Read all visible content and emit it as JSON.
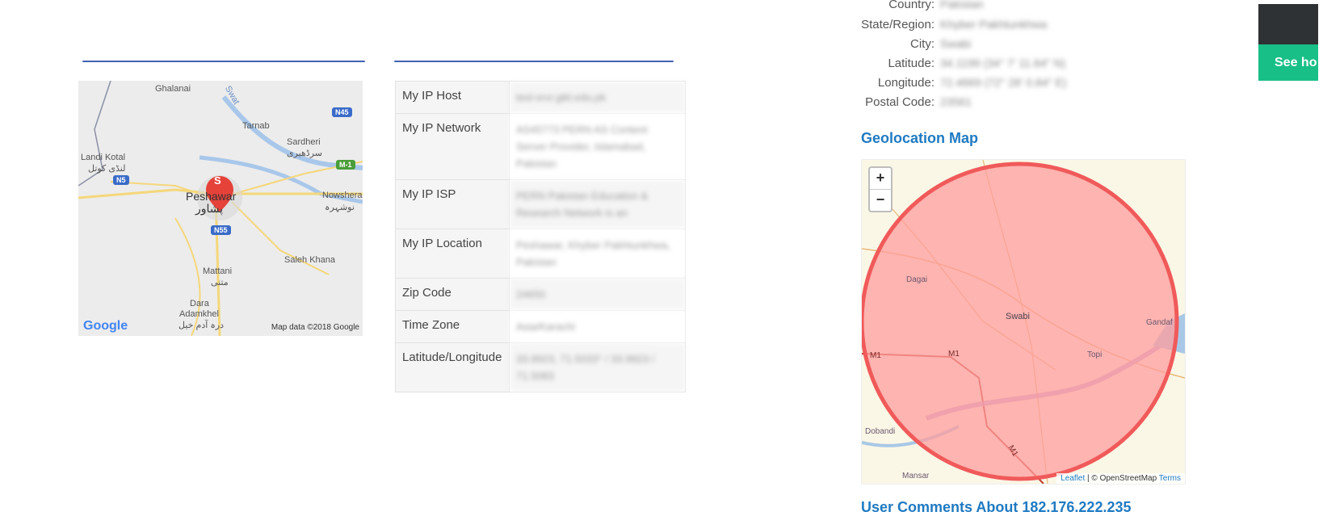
{
  "left_map": {
    "places": [
      "Ghalanai",
      "Tarnab",
      "Sardheri",
      "سرڈھیری",
      "Landi Kotal",
      "لنڈی کوتل",
      "Peshawar",
      "پشاور",
      "Nowshera",
      "نوشہرہ",
      "Saleh Khana",
      "Mattani",
      "متنی",
      "Dara",
      "Adamkhel",
      "درہ آدم خیل",
      "Swat"
    ],
    "shields": [
      "N45",
      "M-1",
      "N5",
      "N55"
    ],
    "marker_letter": "S",
    "logo": "Google",
    "attribution": "Map data ©2018 Google"
  },
  "ip_table": {
    "rows": [
      {
        "key": "My IP Host",
        "value": "tesl-srvr.gikl.edu.pk"
      },
      {
        "key": "My IP Network",
        "value": "AS45773 PERN AS Content Server Provider, Islamabad, Pakistan"
      },
      {
        "key": "My IP ISP",
        "value": "PERN Pakistan Education & Research Network is an"
      },
      {
        "key": "My IP Location",
        "value": "Peshawar, Khyber Pakhtunkhwa, Pakistan"
      },
      {
        "key": "Zip Code",
        "value": "24650"
      },
      {
        "key": "Time Zone",
        "value": "Asia/Karachi"
      },
      {
        "key": "Latitude/Longitude",
        "value": "33.9923, 71.5033° / 33.9923 / 71.5083"
      }
    ]
  },
  "info": {
    "rows": [
      {
        "label": "Country:",
        "value": "Pakistan"
      },
      {
        "label": "State/Region:",
        "value": "Khyber Pakhtunkhwa"
      },
      {
        "label": "City:",
        "value": "Swabi"
      },
      {
        "label": "Latitude:",
        "value": "34.1199 (34° 7' 11.64\" N)"
      },
      {
        "label": "Longitude:",
        "value": "72.4669 (72° 28' 0.84\" E)"
      },
      {
        "label": "Postal Code:",
        "value": "23561"
      }
    ]
  },
  "geo_map": {
    "title": "Geolocation Map",
    "zoom_in": "+",
    "zoom_out": "−",
    "places": [
      "Dagai",
      "Swabi",
      "Gandaf",
      "Topi",
      "M1",
      "M1",
      "M1",
      "Dobandi",
      "Mansar"
    ],
    "attribution_leaflet": "Leaflet",
    "attribution_osm": " | © OpenStreetMap ",
    "attribution_terms": "Terms"
  },
  "comments": {
    "title": "User Comments About 182.176.222.235"
  },
  "ad": {
    "button_label": "See ho"
  },
  "colors": {
    "accent": "#1f7ac2",
    "rule": "#3f62b0",
    "circle_fill": "#ff9e9e",
    "circle_stroke": "#f05a5a"
  }
}
